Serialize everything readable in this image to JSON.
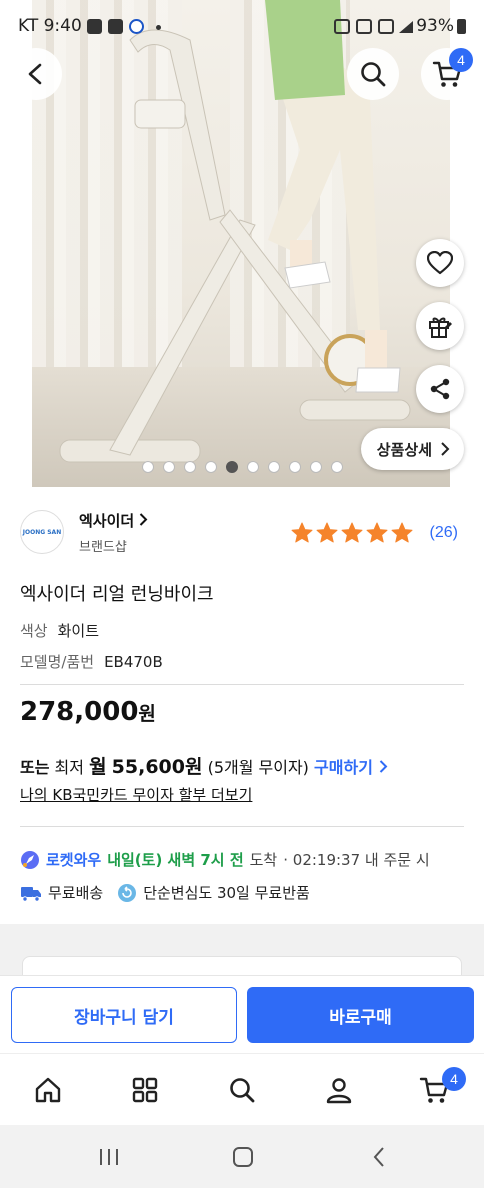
{
  "status_bar": {
    "carrier_time": "KT 9:40",
    "battery": "93%"
  },
  "nav": {
    "cart_count": "4"
  },
  "hero": {
    "detail_button_label": "상품상세",
    "carousel_total": 10,
    "carousel_active_index": 4
  },
  "brand": {
    "logo_text": "JOONG SAN",
    "name": "엑사이더",
    "subtitle": "브랜드샵",
    "rating_stars": 5,
    "review_count": "(26)"
  },
  "product": {
    "title": "엑사이더 리얼 런닝바이크",
    "color_label": "색상",
    "color_value": "화이트",
    "model_label": "모델명/품번",
    "model_value": "EB470B"
  },
  "pricing": {
    "price_number": "278,000",
    "price_unit": "원",
    "install_prefix": "또는",
    "install_min": "최저",
    "install_month": "월",
    "install_amount": "55,600원",
    "install_terms": "(5개월 무이자)",
    "install_link": "구매하기",
    "kb_link": "나의 KB국민카드 무이자 할부 더보기"
  },
  "delivery": {
    "rocket_label": "로켓와우",
    "arrival": "내일(토) 새벽 7시 전",
    "arrival_suffix": "도착",
    "countdown": "· 02:19:37 내 주문 시",
    "free_shipping": "무료배송",
    "free_return": "단순변심도 30일 무료반품"
  },
  "actions": {
    "add_to_cart": "장바구니 담기",
    "buy_now": "바로구매"
  },
  "tabbar": {
    "cart_count": "4"
  },
  "colors": {
    "accent": "#2f6bf6",
    "star": "#f5842b",
    "arrival_green": "#1e9e4a"
  }
}
